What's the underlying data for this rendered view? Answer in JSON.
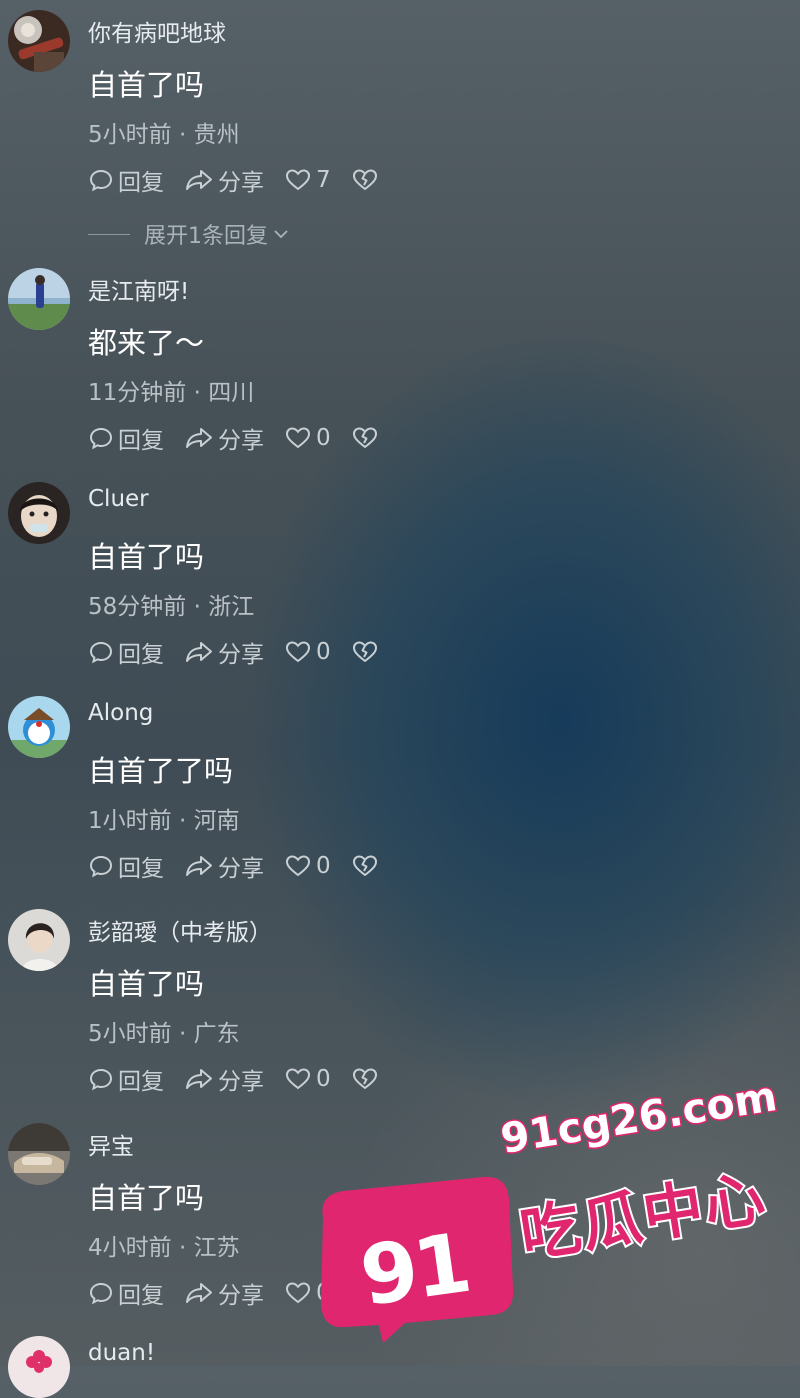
{
  "comments": [
    {
      "username": "你有病吧地球",
      "text": "自首了吗",
      "meta": "5小时前 · 贵州",
      "reply_label": "回复",
      "share_label": "分享",
      "likes": "7",
      "expand_label": "展开1条回复"
    },
    {
      "username": "是江南呀!",
      "text": "都来了～",
      "meta": "11分钟前 · 四川",
      "reply_label": "回复",
      "share_label": "分享",
      "likes": "0"
    },
    {
      "username": "Cluer",
      "text": "自首了吗",
      "meta": "58分钟前 · 浙江",
      "reply_label": "回复",
      "share_label": "分享",
      "likes": "0"
    },
    {
      "username": "Along",
      "text": "自首了了吗",
      "meta": "1小时前 · 河南",
      "reply_label": "回复",
      "share_label": "分享",
      "likes": "0"
    },
    {
      "username": "彭韶璦（中考版）",
      "text": "自首了吗",
      "meta": "5小时前 · 广东",
      "reply_label": "回复",
      "share_label": "分享",
      "likes": "0"
    },
    {
      "username": "异宝",
      "text": "自首了吗",
      "meta": "4小时前 · 江苏",
      "reply_label": "回复",
      "share_label": "分享",
      "likes": "0"
    },
    {
      "username": "duan!"
    }
  ],
  "watermark": {
    "badge_number": "91",
    "domain": "91cg26.com",
    "title": "吃瓜中心"
  },
  "icons": {
    "reply": "comment-bubble-icon",
    "share": "share-arrow-icon",
    "like": "heart-icon",
    "dislike": "broken-heart-icon",
    "expand": "chevron-down-icon"
  },
  "colors": {
    "watermark_accent": "#e0266e"
  }
}
